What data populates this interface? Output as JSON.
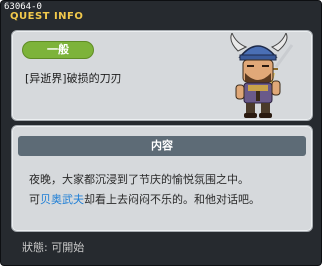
{
  "window": {
    "quest_id": "63064-0",
    "title": "QUEST INFO"
  },
  "quest": {
    "category": "一般",
    "name": "[异逝界]破损的刀刃"
  },
  "content": {
    "header": "内容",
    "line1": "夜晚，大家都沉浸到了节庆的愉悦氛围之中。",
    "line2_prefix": "可",
    "npc_name": "贝奥武夫",
    "line2_suffix": "却看上去闷闷不乐的。和他对话吧。"
  },
  "status": {
    "text": "狀態:  可開始"
  },
  "icons": {
    "portrait": "viking-warrior-npc-portrait"
  },
  "colors": {
    "window_bg": "#262a2f",
    "title": "#f2c94c",
    "badge": "#7db33a",
    "npc_highlight": "#1f7fd6",
    "section_header": "#5d6b76"
  }
}
